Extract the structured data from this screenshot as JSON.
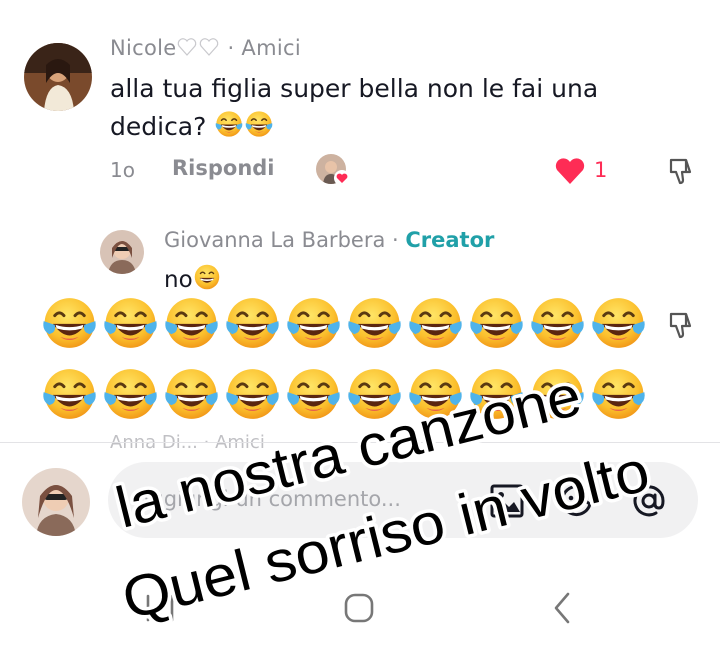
{
  "comment": {
    "author": "Nicole",
    "relation": "· Amici",
    "text": "alla tua figlia super bella non le fai una dedica?",
    "time": "1o",
    "reply_label": "Rispondi",
    "like_count": "1"
  },
  "reply": {
    "author": "Giovanna La Barbera",
    "separator": " · ",
    "badge": "Creator",
    "text": "no"
  },
  "faded_row": {
    "author": "Anna Di... · Amici"
  },
  "input": {
    "placeholder": "Aggiungi un commento..."
  },
  "overlay_text": {
    "line1": "la nostra canzone",
    "line2": "Quel sorriso in volto"
  },
  "colors": {
    "like": "#fe2c55",
    "creator": "#20a0a8",
    "muted": "#8a8b91"
  },
  "icons": [
    "heart-icon",
    "dislike-icon",
    "image-icon",
    "emoji-icon",
    "mention-icon",
    "nav-recents-icon",
    "nav-home-icon",
    "nav-back-icon"
  ]
}
